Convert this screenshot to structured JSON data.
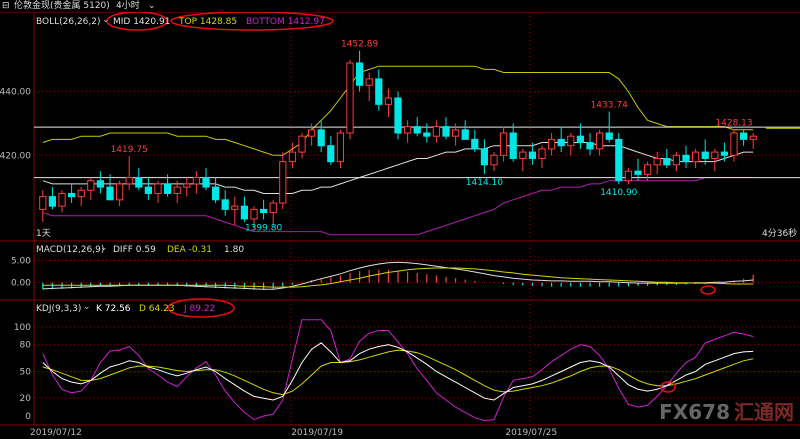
{
  "window": {
    "title": "伦敦金现(贵金属 5120)",
    "timeframe": "4小时"
  },
  "colors": {
    "background": "#000000",
    "up": "#ff3c3c",
    "down": "#00e5e5",
    "mid": "#e0e0e0",
    "top": "#c9c900",
    "bottom": "#b01fb0",
    "grid": "#8b0000",
    "highlight": "#e01010",
    "diff": "#e0e0e0",
    "dea": "#d6d600",
    "k": "#ffffff",
    "d": "#d6d600",
    "j": "#d020d0"
  },
  "boll": {
    "label": "BOLL(26,26,2)",
    "mid": "MID 1420.91",
    "top": "TOP 1428.85",
    "bottom": "BOTTOM 1412.97"
  },
  "macd": {
    "label": "MACD(12,26,9)",
    "diff": "DIFF 0.59",
    "dea": "DEA -0.31",
    "macd": "1.80"
  },
  "kdj": {
    "label": "KDJ(9,3,3)",
    "k": "K 72.56",
    "d": "D 64.23",
    "j": "J 89.22"
  },
  "status": {
    "left": "1天",
    "countdown": "4分36秒"
  },
  "price_axis": [
    "1440.00",
    "1420.00"
  ],
  "macd_axis": [
    "5.00",
    "0.00"
  ],
  "kdj_axis": [
    "100",
    "80",
    "50",
    "20",
    "0"
  ],
  "date_axis": [
    "2019/07/12",
    "2019/07/19",
    "2019/07/25"
  ],
  "annotations": {
    "high1": "1452.89",
    "high2": "1433.74",
    "high3": "1428.13",
    "high0": "1419.75",
    "low1": "1399.80",
    "low2": "1414.10",
    "low3": "1410.90"
  },
  "watermark": {
    "brand": "FX678",
    "cn": "汇通网"
  },
  "chart_data": {
    "type": "candlestick",
    "price_ylim": [
      1394,
      1460
    ],
    "reference_lines": [
      1428.85,
      1412.97
    ],
    "candles": [
      {
        "o": 1403,
        "h": 1409,
        "l": 1399,
        "c": 1407
      },
      {
        "o": 1407,
        "h": 1410,
        "l": 1403,
        "c": 1404
      },
      {
        "o": 1404,
        "h": 1409,
        "l": 1402,
        "c": 1408
      },
      {
        "o": 1408,
        "h": 1411,
        "l": 1405,
        "c": 1407
      },
      {
        "o": 1407,
        "h": 1410,
        "l": 1404,
        "c": 1409
      },
      {
        "o": 1409,
        "h": 1413,
        "l": 1406,
        "c": 1412
      },
      {
        "o": 1412,
        "h": 1415,
        "l": 1408,
        "c": 1410
      },
      {
        "o": 1410,
        "h": 1414,
        "l": 1406,
        "c": 1406
      },
      {
        "o": 1406,
        "h": 1412,
        "l": 1404,
        "c": 1411
      },
      {
        "o": 1411,
        "h": 1419.75,
        "l": 1409,
        "c": 1413
      },
      {
        "o": 1413,
        "h": 1416,
        "l": 1409,
        "c": 1410
      },
      {
        "o": 1410,
        "h": 1413,
        "l": 1406,
        "c": 1408
      },
      {
        "o": 1408,
        "h": 1412,
        "l": 1405,
        "c": 1411
      },
      {
        "o": 1411,
        "h": 1414,
        "l": 1407,
        "c": 1408
      },
      {
        "o": 1408,
        "h": 1412,
        "l": 1405,
        "c": 1410
      },
      {
        "o": 1410,
        "h": 1413,
        "l": 1407,
        "c": 1411
      },
      {
        "o": 1411,
        "h": 1415,
        "l": 1408,
        "c": 1413
      },
      {
        "o": 1413,
        "h": 1416,
        "l": 1409,
        "c": 1410
      },
      {
        "o": 1410,
        "h": 1413,
        "l": 1405,
        "c": 1406
      },
      {
        "o": 1406,
        "h": 1409,
        "l": 1401,
        "c": 1403
      },
      {
        "o": 1403,
        "h": 1407,
        "l": 1398,
        "c": 1404
      },
      {
        "o": 1404,
        "h": 1407,
        "l": 1399,
        "c": 1400
      },
      {
        "o": 1400,
        "h": 1404,
        "l": 1397,
        "c": 1403
      },
      {
        "o": 1403,
        "h": 1406,
        "l": 1399.8,
        "c": 1402
      },
      {
        "o": 1402,
        "h": 1406,
        "l": 1398,
        "c": 1405
      },
      {
        "o": 1405,
        "h": 1421,
        "l": 1403,
        "c": 1418
      },
      {
        "o": 1418,
        "h": 1424,
        "l": 1416,
        "c": 1421
      },
      {
        "o": 1421,
        "h": 1427,
        "l": 1419,
        "c": 1426
      },
      {
        "o": 1426,
        "h": 1430,
        "l": 1423,
        "c": 1428
      },
      {
        "o": 1428,
        "h": 1431,
        "l": 1421,
        "c": 1423
      },
      {
        "o": 1423,
        "h": 1426,
        "l": 1417,
        "c": 1418
      },
      {
        "o": 1418,
        "h": 1428,
        "l": 1416,
        "c": 1427
      },
      {
        "o": 1427,
        "h": 1450,
        "l": 1425,
        "c": 1449
      },
      {
        "o": 1449,
        "h": 1452.89,
        "l": 1440,
        "c": 1442
      },
      {
        "o": 1442,
        "h": 1446,
        "l": 1437,
        "c": 1444
      },
      {
        "o": 1444,
        "h": 1447,
        "l": 1434,
        "c": 1436
      },
      {
        "o": 1436,
        "h": 1441,
        "l": 1432,
        "c": 1438
      },
      {
        "o": 1438,
        "h": 1440,
        "l": 1425,
        "c": 1427
      },
      {
        "o": 1427,
        "h": 1431,
        "l": 1424,
        "c": 1429
      },
      {
        "o": 1429,
        "h": 1432,
        "l": 1426,
        "c": 1427
      },
      {
        "o": 1427,
        "h": 1430,
        "l": 1424,
        "c": 1426
      },
      {
        "o": 1426,
        "h": 1431,
        "l": 1424,
        "c": 1429
      },
      {
        "o": 1429,
        "h": 1432,
        "l": 1425,
        "c": 1426
      },
      {
        "o": 1426,
        "h": 1430,
        "l": 1423,
        "c": 1428
      },
      {
        "o": 1428,
        "h": 1431,
        "l": 1425,
        "c": 1425
      },
      {
        "o": 1425,
        "h": 1428,
        "l": 1421,
        "c": 1422
      },
      {
        "o": 1422,
        "h": 1425,
        "l": 1414.1,
        "c": 1417
      },
      {
        "o": 1417,
        "h": 1421,
        "l": 1415,
        "c": 1420
      },
      {
        "o": 1420,
        "h": 1429,
        "l": 1418,
        "c": 1427
      },
      {
        "o": 1427,
        "h": 1430,
        "l": 1418,
        "c": 1419
      },
      {
        "o": 1419,
        "h": 1422,
        "l": 1415,
        "c": 1421
      },
      {
        "o": 1421,
        "h": 1424,
        "l": 1417,
        "c": 1419
      },
      {
        "o": 1419,
        "h": 1423,
        "l": 1416,
        "c": 1422
      },
      {
        "o": 1422,
        "h": 1427,
        "l": 1420,
        "c": 1425
      },
      {
        "o": 1425,
        "h": 1429,
        "l": 1421,
        "c": 1423
      },
      {
        "o": 1423,
        "h": 1427,
        "l": 1420,
        "c": 1426
      },
      {
        "o": 1426,
        "h": 1430,
        "l": 1422,
        "c": 1424
      },
      {
        "o": 1424,
        "h": 1427,
        "l": 1420,
        "c": 1422
      },
      {
        "o": 1422,
        "h": 1428,
        "l": 1420,
        "c": 1427
      },
      {
        "o": 1427,
        "h": 1433.74,
        "l": 1424,
        "c": 1425
      },
      {
        "o": 1425,
        "h": 1427,
        "l": 1410.9,
        "c": 1412
      },
      {
        "o": 1412,
        "h": 1416,
        "l": 1410.9,
        "c": 1415
      },
      {
        "o": 1415,
        "h": 1419,
        "l": 1412,
        "c": 1414
      },
      {
        "o": 1414,
        "h": 1418,
        "l": 1412,
        "c": 1417
      },
      {
        "o": 1417,
        "h": 1421,
        "l": 1414,
        "c": 1419
      },
      {
        "o": 1419,
        "h": 1422,
        "l": 1416,
        "c": 1417
      },
      {
        "o": 1417,
        "h": 1421,
        "l": 1415,
        "c": 1420
      },
      {
        "o": 1420,
        "h": 1423,
        "l": 1416,
        "c": 1418
      },
      {
        "o": 1418,
        "h": 1422,
        "l": 1416,
        "c": 1421
      },
      {
        "o": 1421,
        "h": 1425,
        "l": 1417,
        "c": 1419
      },
      {
        "o": 1419,
        "h": 1422,
        "l": 1415,
        "c": 1421
      },
      {
        "o": 1421,
        "h": 1424,
        "l": 1418,
        "c": 1420
      },
      {
        "o": 1420,
        "h": 1428.13,
        "l": 1418,
        "c": 1427
      },
      {
        "o": 1427,
        "h": 1428,
        "l": 1423,
        "c": 1425
      },
      {
        "o": 1425,
        "h": 1427,
        "l": 1422,
        "c": 1426
      }
    ],
    "mid_line": [
      1412,
      1411,
      1411,
      1411,
      1411,
      1411,
      1411,
      1411,
      1411,
      1411,
      1411,
      1411,
      1411,
      1411,
      1411,
      1411,
      1411,
      1411,
      1411,
      1410,
      1410,
      1409,
      1409,
      1408,
      1408,
      1408,
      1408,
      1409,
      1409,
      1410,
      1410,
      1411,
      1412,
      1413,
      1414,
      1415,
      1416,
      1417,
      1418,
      1419,
      1419,
      1420,
      1421,
      1421,
      1422,
      1422,
      1422,
      1423,
      1423,
      1423,
      1423,
      1423,
      1424,
      1424,
      1424,
      1424,
      1424,
      1424,
      1423,
      1423,
      1423,
      1422,
      1421,
      1420,
      1419,
      1419,
      1418,
      1418,
      1418,
      1418,
      1418,
      1419,
      1420,
      1421,
      1421
    ],
    "top_line": [
      1424,
      1425,
      1425,
      1425,
      1426,
      1426,
      1426,
      1427,
      1427,
      1427,
      1427,
      1427,
      1427,
      1427,
      1426,
      1426,
      1426,
      1426,
      1425,
      1425,
      1424,
      1423,
      1422,
      1421,
      1420,
      1420,
      1422,
      1424,
      1428,
      1431,
      1434,
      1438,
      1442,
      1446,
      1447,
      1448,
      1448,
      1448,
      1448,
      1448,
      1448,
      1448,
      1448,
      1448,
      1448,
      1448,
      1447,
      1447,
      1446,
      1446,
      1446,
      1446,
      1446,
      1446,
      1446,
      1446,
      1446,
      1446,
      1446,
      1446,
      1444,
      1440,
      1435,
      1431,
      1430,
      1429,
      1429,
      1429,
      1429,
      1429,
      1429,
      1429,
      1428,
      1428,
      1428
    ],
    "bottom_line": [
      1402,
      1401,
      1401,
      1401,
      1401,
      1401,
      1401,
      1401,
      1401,
      1401,
      1401,
      1401,
      1401,
      1401,
      1401,
      1401,
      1401,
      1401,
      1400,
      1399,
      1398,
      1397,
      1396,
      1396,
      1396,
      1396,
      1396,
      1396,
      1396,
      1396,
      1395,
      1395,
      1395,
      1395,
      1395,
      1395,
      1395,
      1395,
      1395,
      1395,
      1396,
      1397,
      1398,
      1399,
      1400,
      1401,
      1402,
      1403,
      1405,
      1406,
      1407,
      1408,
      1409,
      1409,
      1410,
      1410,
      1410,
      1411,
      1411,
      1412,
      1412,
      1412,
      1412,
      1412,
      1412,
      1412,
      1412,
      1412,
      1412,
      1413,
      1413,
      1413,
      1413,
      1413,
      1413
    ],
    "macd_ylim": [
      -3,
      6
    ],
    "macd_hist": [
      -1.5,
      -1.5,
      -1.4,
      -1.3,
      -1.2,
      -1,
      -0.9,
      -0.9,
      -0.8,
      -0.7,
      -0.7,
      -0.7,
      -0.7,
      -0.7,
      -0.8,
      -0.9,
      -1,
      -1.1,
      -1.2,
      -1.3,
      -1.4,
      -1.5,
      -1.6,
      -1.6,
      -1.4,
      -0.9,
      -0.4,
      0.1,
      0.6,
      0.9,
      1.2,
      1.6,
      2.2,
      2.6,
      2.8,
      2.9,
      2.9,
      2.7,
      2.5,
      2.2,
      1.9,
      1.6,
      1.3,
      1,
      0.7,
      0.4,
      0.1,
      -0.1,
      -0.3,
      -0.5,
      -0.6,
      -0.7,
      -0.8,
      -0.9,
      -0.9,
      -0.9,
      -0.9,
      -0.9,
      -0.9,
      -0.9,
      -0.9,
      -0.8,
      -0.7,
      -0.7,
      -0.6,
      -0.5,
      -0.5,
      -0.4,
      -0.3,
      -0.3,
      -0.2,
      -0.1,
      0.4,
      0.9,
      1.8
    ],
    "macd_diff": [
      -1.4,
      -1.3,
      -1.2,
      -1.1,
      -1,
      -0.9,
      -0.8,
      -0.8,
      -0.7,
      -0.6,
      -0.6,
      -0.6,
      -0.6,
      -0.6,
      -0.6,
      -0.7,
      -0.8,
      -0.9,
      -1,
      -1.1,
      -1.2,
      -1.3,
      -1.4,
      -1.5,
      -1.5,
      -1.2,
      -0.8,
      -0.3,
      0.3,
      0.9,
      1.4,
      2,
      2.7,
      3.3,
      3.8,
      4.2,
      4.5,
      4.6,
      4.5,
      4.3,
      4,
      3.7,
      3.4,
      3.1,
      2.8,
      2.4,
      2,
      1.6,
      1.3,
      1,
      0.8,
      0.6,
      0.5,
      0.4,
      0.4,
      0.3,
      0.3,
      0.3,
      0.2,
      0.2,
      0.1,
      0,
      -0.1,
      -0.1,
      -0.1,
      -0.1,
      -0.1,
      -0.1,
      0,
      0,
      0.1,
      0.1,
      0.3,
      0.4,
      0.59
    ],
    "macd_dea": [
      -0.6,
      -0.6,
      -0.6,
      -0.6,
      -0.6,
      -0.6,
      -0.6,
      -0.6,
      -0.6,
      -0.6,
      -0.6,
      -0.6,
      -0.6,
      -0.6,
      -0.6,
      -0.6,
      -0.6,
      -0.6,
      -0.6,
      -0.6,
      -0.7,
      -0.8,
      -0.8,
      -0.9,
      -1,
      -1,
      -1,
      -0.9,
      -0.7,
      -0.5,
      -0.2,
      0.2,
      0.6,
      1,
      1.5,
      1.9,
      2.3,
      2.6,
      2.9,
      3.1,
      3.2,
      3.3,
      3.3,
      3.3,
      3.2,
      3.1,
      2.9,
      2.7,
      2.4,
      2.2,
      1.9,
      1.7,
      1.5,
      1.3,
      1.1,
      1,
      0.9,
      0.8,
      0.7,
      0.6,
      0.5,
      0.4,
      0.3,
      0.2,
      0.1,
      0.1,
      0,
      0,
      -0.1,
      -0.1,
      -0.1,
      -0.2,
      -0.3,
      -0.3,
      -0.31
    ],
    "kdj_ylim": [
      0,
      110
    ],
    "kdj_k": [
      60,
      50,
      42,
      38,
      36,
      40,
      48,
      55,
      58,
      62,
      60,
      55,
      52,
      48,
      45,
      48,
      52,
      55,
      50,
      42,
      35,
      28,
      22,
      20,
      18,
      22,
      40,
      60,
      75,
      82,
      72,
      60,
      62,
      70,
      75,
      78,
      80,
      77,
      72,
      65,
      58,
      50,
      44,
      38,
      32,
      26,
      20,
      18,
      25,
      32,
      34,
      36,
      40,
      45,
      50,
      55,
      60,
      62,
      60,
      55,
      45,
      35,
      30,
      28,
      30,
      34,
      40,
      46,
      50,
      58,
      62,
      66,
      70,
      72,
      72.56
    ],
    "kdj_d": [
      55,
      52,
      48,
      44,
      40,
      40,
      42,
      46,
      50,
      54,
      56,
      56,
      55,
      53,
      51,
      50,
      51,
      52,
      52,
      49,
      45,
      40,
      35,
      30,
      26,
      24,
      28,
      36,
      46,
      56,
      60,
      60,
      61,
      63,
      66,
      69,
      72,
      74,
      73,
      71,
      67,
      62,
      57,
      52,
      46,
      40,
      34,
      29,
      27,
      28,
      30,
      32,
      34,
      37,
      41,
      45,
      50,
      54,
      56,
      56,
      52,
      46,
      40,
      36,
      34,
      34,
      36,
      39,
      42,
      46,
      50,
      54,
      58,
      62,
      64.23
    ],
    "kdj_j": [
      70,
      46,
      30,
      26,
      28,
      40,
      60,
      73,
      74,
      78,
      68,
      53,
      46,
      38,
      33,
      44,
      54,
      61,
      46,
      28,
      15,
      4,
      -4,
      0,
      2,
      18,
      64,
      108,
      133,
      134,
      96,
      60,
      64,
      84,
      93,
      96,
      96,
      83,
      70,
      53,
      40,
      26,
      18,
      10,
      4,
      -2,
      -8,
      -4,
      21,
      40,
      42,
      44,
      52,
      61,
      68,
      75,
      80,
      78,
      68,
      53,
      31,
      13,
      10,
      12,
      22,
      34,
      48,
      60,
      66,
      82,
      86,
      90,
      94,
      92,
      89.22
    ]
  }
}
